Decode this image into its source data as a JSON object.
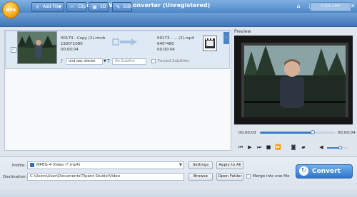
{
  "window": {
    "title": "Tipard MP4 Video Converter (Unregistered)",
    "logo_text": "MP4"
  },
  "toolbar": {
    "add_file": "Add File",
    "clip": "Clip",
    "three_d": "3D",
    "edit": "Edit",
    "cuda_amd": "CUDA  AMD"
  },
  "file": {
    "source_name": "00173 - Copy (2).rmvb",
    "source_resolution": "1920*1080",
    "source_duration": "00:00:04",
    "output_name": "00173 - ... (2).mp4",
    "output_resolution": "640*480",
    "output_duration": "00:00:04",
    "audio_track": "und aac stereo",
    "subtitle": "No Subtitle",
    "forced_subtitles": "Forced Subtitles"
  },
  "preview": {
    "label": "Preview",
    "time_current": "00:00:03",
    "time_total": "00:00:04",
    "progress": 0.7,
    "volume": 0.6
  },
  "bottom": {
    "profile_label": "Profile:",
    "profile_value": "MPEG-4 Video (*.mp4)",
    "settings": "Settings",
    "apply_to_all": "Apply to All",
    "destination_label": "Destination:",
    "destination_value": "C:\\Users\\User\\Documents\\Tipard Studio\\Video",
    "browse": "Browse",
    "open_folder": "Open Folder",
    "merge": "Merge into one file",
    "convert": "Convert"
  },
  "colors": {
    "accent": "#3e7dc4",
    "titlebar": "#4f86c8",
    "convert": "#2f74c9"
  }
}
